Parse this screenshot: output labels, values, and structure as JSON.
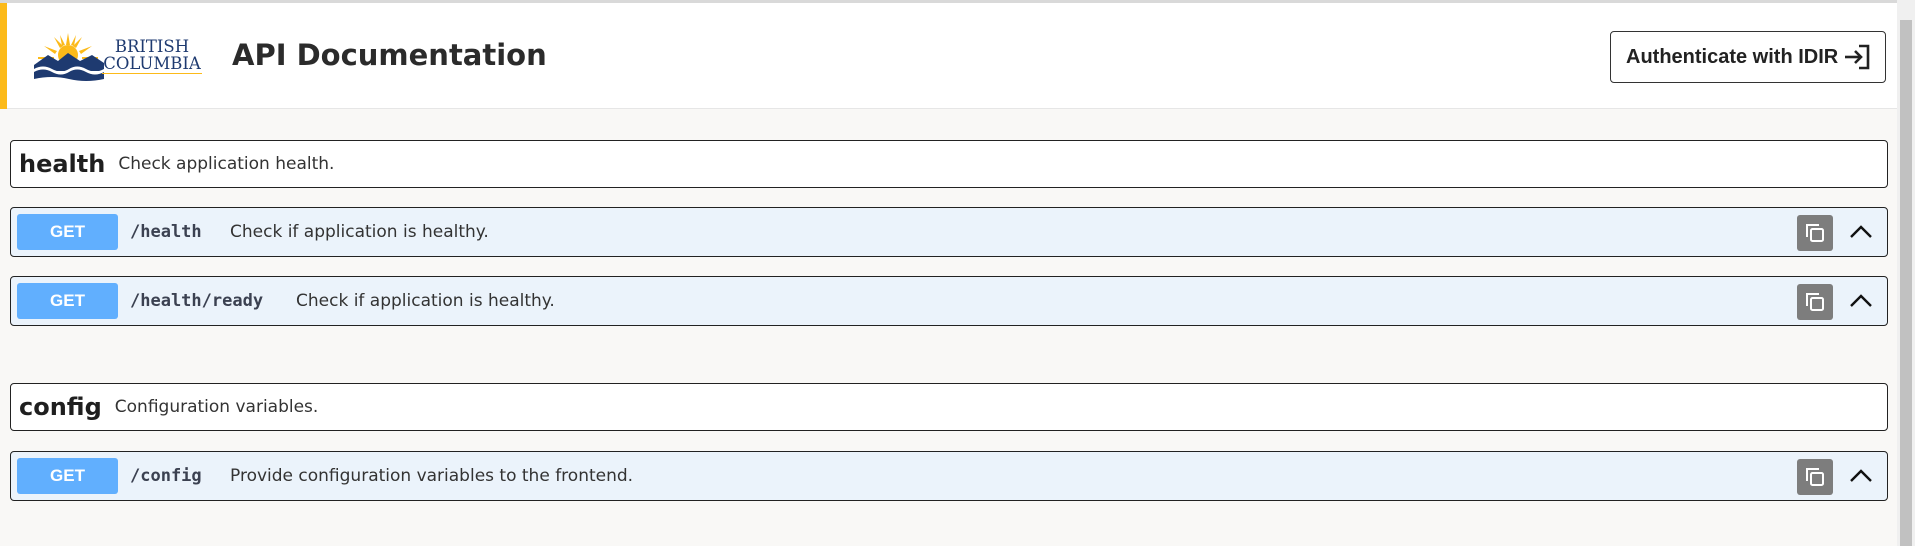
{
  "header": {
    "logo": {
      "line1": "BRITISH",
      "line2": "COLUMBIA"
    },
    "title": "API Documentation",
    "auth_button_label": "Authenticate with IDIR",
    "accent_color": "#fcba19"
  },
  "sections": [
    {
      "name": "health",
      "description": "Check application health.",
      "operations": [
        {
          "method": "GET",
          "path": "/health",
          "summary": "Check if application is healthy."
        },
        {
          "method": "GET",
          "path": "/health/ready",
          "summary": "Check if application is healthy."
        }
      ]
    },
    {
      "name": "config",
      "description": "Configuration variables.",
      "operations": [
        {
          "method": "GET",
          "path": "/config",
          "summary": "Provide configuration variables to the frontend."
        }
      ]
    }
  ],
  "colors": {
    "get_method": "#61affe",
    "operation_bg": "#ebf3fb",
    "copy_button": "#7d7d7d"
  },
  "icons": [
    "bc-logo-sun-icon",
    "login-arrow-icon",
    "copy-icon",
    "chevron-up-icon"
  ]
}
